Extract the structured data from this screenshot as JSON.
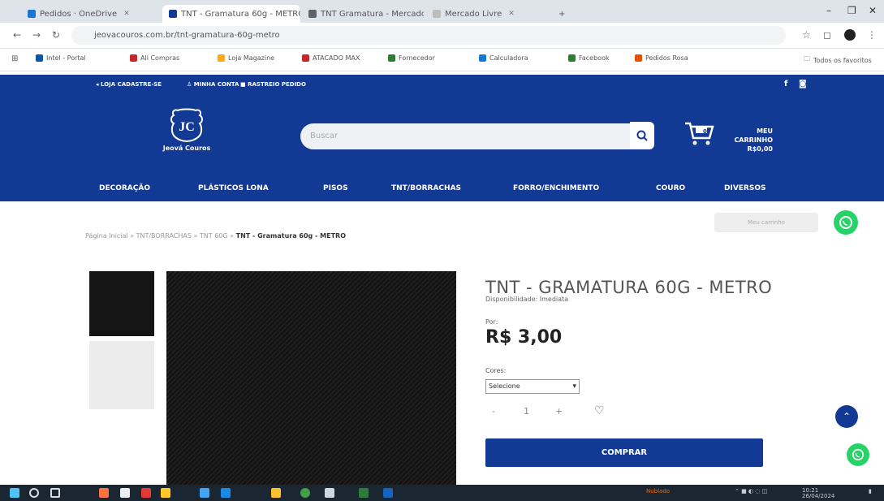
{
  "browser": {
    "tabs": [
      {
        "label": "Pedidos · OneDrive",
        "active": false,
        "color": "#1976d2"
      },
      {
        "label": "TNT - Gramatura 60g - METRO",
        "active": true,
        "color": "#123a94"
      },
      {
        "label": "TNT Gramatura - Mercado",
        "active": false,
        "color": "#5f6368"
      },
      {
        "label": "Mercado Livre",
        "active": false,
        "color": "#bdbdbd"
      }
    ],
    "new_tab": "+",
    "url": "jeovacouros.com.br/tnt-gramatura-60g-metro",
    "bookmarks": [
      {
        "label": "Intel - Portal",
        "color": "#0a57a8"
      },
      {
        "label": "Ali Compras",
        "color": "#c62828"
      },
      {
        "label": "Loja Magazine",
        "color": "#f9a825"
      },
      {
        "label": "ATACADO MAX",
        "color": "#c62828"
      },
      {
        "label": "Fornecedor",
        "color": "#2e7d32"
      },
      {
        "label": "Calculadora",
        "color": "#1976d2"
      },
      {
        "label": "Facebook",
        "color": "#2e7d32"
      },
      {
        "label": "Pedidos Rosa",
        "color": "#e65100"
      }
    ],
    "other_bookmarks": "Todos os favoritos"
  },
  "site": {
    "top_links": [
      "LOJA CADASTRE-SE",
      "MINHA CONTA",
      "RASTREIO PEDIDO"
    ],
    "social": [
      "f",
      "◙"
    ],
    "logo_text": "Jeová Couros",
    "search_placeholder": "Buscar",
    "cart_label": "MEU CARRINHO",
    "cart_total": "R$0,00",
    "cart_count": "0",
    "menu": [
      "DECORAÇÃO",
      "PLÁSTICOS LONA",
      "PISOS",
      "TNT/BORRACHAS",
      "FORRO/ENCHIMENTO",
      "COURO",
      "DIVERSOS"
    ],
    "brand_color": "#123a94",
    "whatsapp_color": "#25d366"
  },
  "product": {
    "breadcrumb": [
      "Página Inicial",
      "TNT/BORRACHAS",
      "TNT 60G"
    ],
    "breadcrumb_current": "TNT - Gramatura 60g - METRO",
    "login_pill": "Meu carrinho",
    "title": "TNT - GRAMATURA 60G - METRO",
    "availability": "Disponibilidade: Imediata",
    "price_prefix": "Por:",
    "price": "R$ 3,00",
    "option_label": "Cores:",
    "option_value": "Selecione",
    "qty_minus": "-",
    "qty_value": "1",
    "qty_plus": "+",
    "buy_label": "COMPRAR"
  },
  "taskbar": {
    "tray_weather": "Nublado",
    "time": "10:21",
    "date": "26/04/2024"
  }
}
